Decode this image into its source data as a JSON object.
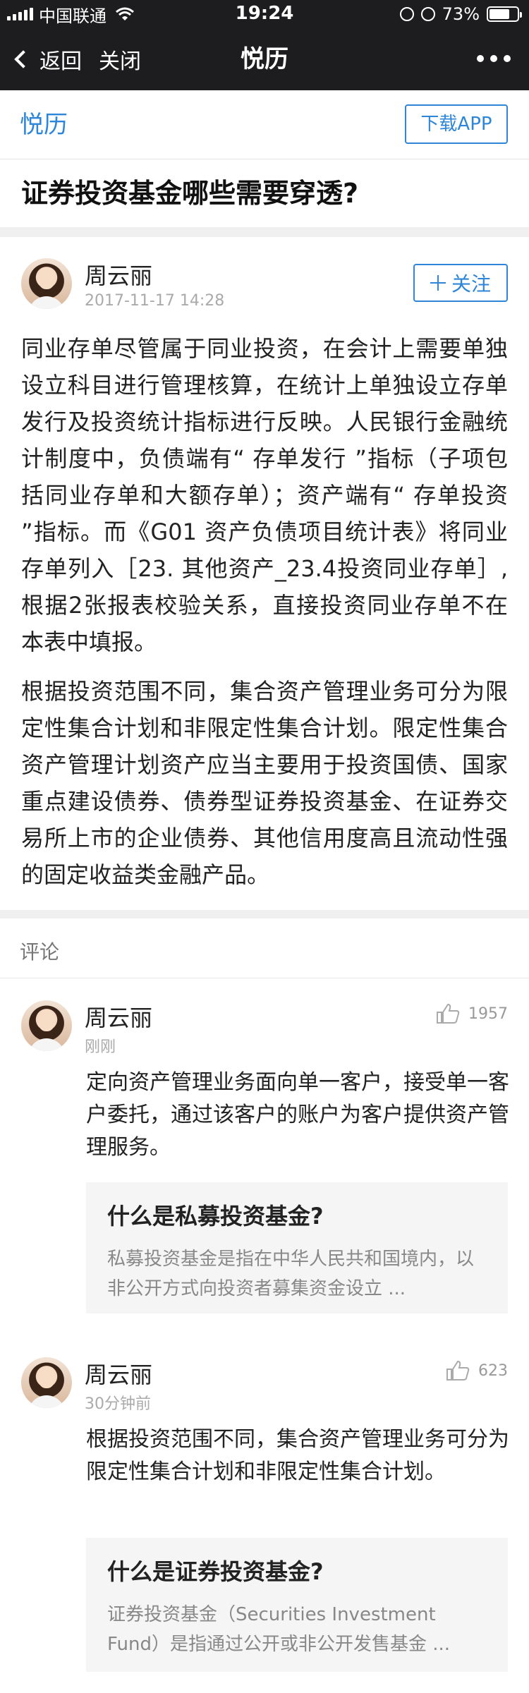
{
  "status_bar": {
    "carrier": "中国联通",
    "time": "19:24",
    "battery": "73%",
    "battery_level": 0.73,
    "icons": [
      "signal-icon",
      "wifi-icon",
      "orientation-lock-icon",
      "alarm-icon",
      "battery-icon"
    ]
  },
  "nav": {
    "back_label": "返回",
    "close_label": "关闭",
    "title": "悦历",
    "more_icon": "more-icon"
  },
  "app_banner": {
    "name": "悦历",
    "download_label": "下载APP"
  },
  "article": {
    "title": "证券投资基金哪些需要穿透?",
    "author": "周云丽",
    "time": "2017-11-17 14:28",
    "follow_label": "关注",
    "paragraphs": [
      "同业存单尽管属于同业投资，在会计上需要单独设立科目进行管理核算，在统计上单独设立存单发行及投资统计指标进行反映。人民银行金融统计制度中，负债端有“ 存单发行 ”指标（子项包括同业存单和大额存单）；资产端有“ 存单投资 ”指标。而《G01 资产负债项目统计表》将同业存单列入［23. 其他资产_23.4投资同业存单］,根据2张报表校验关系，直接投资同业存单不在本表中填报。",
      "根据投资范围不同，集合资产管理业务可分为限定性集合计划和非限定性集合计划。限定性集合资产管理计划资产应当主要用于投资国债、国家重点建设债券、债券型证券投资基金、在证券交易所上市的企业债券、其他信用度高且流动性强的固定收益类金融产品。"
    ]
  },
  "comments_section": {
    "label": "评论",
    "items": [
      {
        "author": "周云丽",
        "time": "刚刚",
        "likes": "1957",
        "text": "定向资产管理业务面向单一客户，接受单一客户委托，通过该客户的账户为客户提供资产管理服务。",
        "card_title": "什么是私募投资基金?",
        "card_desc": "私募投资基金是指在中华人民共和国境内，以非公开方式向投资者募集资金设立 ..."
      },
      {
        "author": "周云丽",
        "time": "30分钟前",
        "likes": "623",
        "text": "根据投资范围不同，集合资产管理业务可分为限定性集合计划和非限定性集合计划。",
        "card_title": "什么是证券投资基金?",
        "card_desc": "证券投资基金（Securities Investment Fund）是指通过公开或非公开发售基金 ..."
      }
    ]
  },
  "colors": {
    "accent": "#2f86d8",
    "nav_background": "#1d1d1f",
    "card_background": "#f5f5f5"
  }
}
